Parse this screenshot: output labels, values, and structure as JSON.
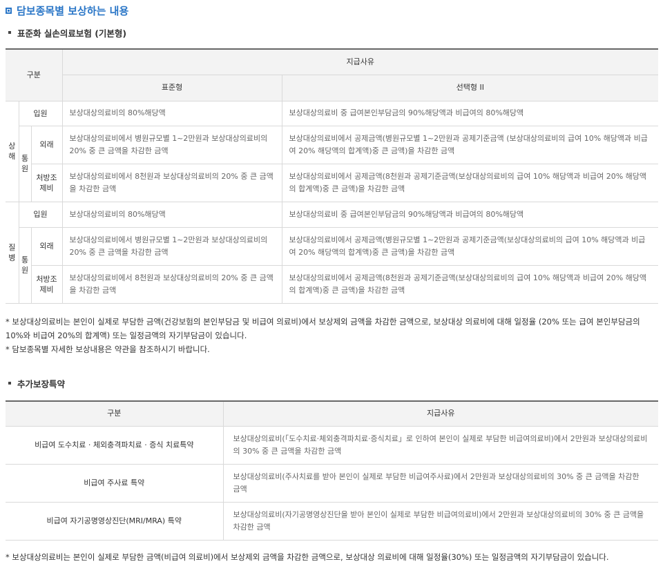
{
  "section_title": "담보종목별 보상하는 내용",
  "sub1_title": "표준화 실손의료보험 (기본형)",
  "table1": {
    "col_gubun": "구분",
    "col_payment": "지급사유",
    "col_standard": "표준형",
    "col_option": "선택형 II",
    "injury": "상해",
    "disease": "질병",
    "outpatient_group": "통원",
    "rows": [
      {
        "label": "입원",
        "standard": "보상대상의료비의 80%해당액",
        "option": "보상대상의료비 중 급여본인부담금의 90%해당액과 비급여의 80%해당액"
      },
      {
        "label": "외래",
        "standard": "보상대상의료비에서 병원규모별 1~2만원과 보상대상의료비의 20% 중 큰 금액을 차감한 금액",
        "option": "보상대상의료비에서 공제금액(병원규모별 1~2만원과 공제기준금액 (보상대상의료비의 급여 10% 해당액과 비급여 20% 해당액의 합계액)중 큰 금액)을 차감한 금액"
      },
      {
        "label": "처방조제비",
        "standard": "보상대상의료비에서 8천원과 보상대상의료비의 20% 중 큰 금액을 차감한 금액",
        "option": "보상대상의료비에서 공제금액(8천원과 공제기준금액(보상대상의료비의 급여 10% 해당액과 비급여 20% 해당액의 합계액)중 큰 금액)을 차감한 금액"
      },
      {
        "label": "입원",
        "standard": "보상대상의료비의 80%해당액",
        "option": "보상대상의료비 중 급여본인부담금의 90%해당액과 비급여의 80%해당액"
      },
      {
        "label": "외래",
        "standard": "보상대상의료비에서 병원규모별 1~2만원과 보상대상의료비의 20% 중 큰 금액을 차감한 금액",
        "option": "보상대상의료비에서 공제금액(병원규모별 1~2만원과 공제기준금액(보상대상의료비의 급여 10% 해당액과 비급여 20% 해당액의 합계액)중 큰 금액)을 차감한 금액"
      },
      {
        "label": "처방조제비",
        "standard": "보상대상의료비에서 8천원과 보상대상의료비의 20% 중 큰 금액을 차감한 금액",
        "option": "보상대상의료비에서 공제금액(8천원과 공제기준금액(보상대상의료비의 급여 10% 해당액과 비급여 20% 해당액의 합계액)중 큰 금액)을 차감한 금액"
      }
    ]
  },
  "note1": "* 보상대상의료비는 본인이 실제로 부담한 금액(건강보험의 본인부담금 및 비급여 의료비)에서 보상제외 금액을 차감한 금액으로, 보상대상 의료비에 대해 일정율 (20% 또는 급여 본인부담금의 10%와 비급여 20%의 합계액) 또는 일정금액의 자기부담금이 있습니다.",
  "note2": "* 담보종목별 자세한 보상내용은 약관을 참조하시기 바랍니다.",
  "sub2_title": "추가보장특약",
  "table2": {
    "col_gubun": "구분",
    "col_payment": "지급사유",
    "rows": [
      {
        "label": "비급여 도수치료 · 체외충격파치료 · 증식 치료특약",
        "desc": "보상대상의료비(「도수치료·체외충격파치료·증식치료」로 인하여 본인이 실제로 부담한 비급여의료비)에서 2만원과 보상대상의료비의 30% 중 큰 금액을 차감한 금액"
      },
      {
        "label": "비급여 주사료 특약",
        "desc": "보상대상의료비(주사치료를 받아 본인이 실제로 부담한 비급여주사료)에서 2만원과 보상대상의료비의 30% 중 큰 금액을 차감한 금액"
      },
      {
        "label": "비급여 자기공명영상진단(MRI/MRA) 특약",
        "desc": "보상대상의료비(자기공명영상진단을 받아 본인이 실제로 부담한 비급여의료비)에서 2만원과 보상대상의료비의 30% 중 큰 금액을 차감한 금액"
      }
    ]
  },
  "note3": "* 보상대상의료비는 본인이 실제로 부담한 금액(비급여 의료비)에서 보상제외 금액을 차감한 금액으로, 보상대상 의료비에 대해 일정율(30%) 또는 일정금액의 자기부담금이 있습니다."
}
